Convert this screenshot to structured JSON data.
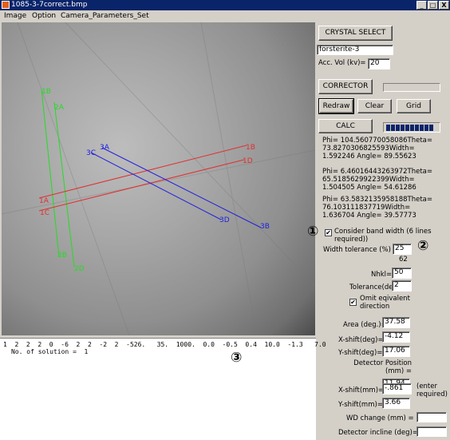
{
  "window": {
    "title": "1085-3-7correct.bmp",
    "min_label": "_",
    "max_label": "□",
    "close_label": "X"
  },
  "menu": {
    "items": [
      "Image",
      "Option",
      "Camera_Parameters_Set"
    ]
  },
  "image": {
    "band_labels": {
      "green": [
        "1B",
        "2A",
        "2B",
        "2D"
      ],
      "red": [
        "1B",
        "1D",
        "1A",
        "1C"
      ],
      "blue": [
        "3A",
        "3C",
        "3D",
        "3B"
      ]
    },
    "colors": {
      "green": "#22dd22",
      "red": "#e03030",
      "blue": "#2020e0"
    }
  },
  "console": {
    "line1": "1  2  2  2  0  -6  2  2  -2  2  -526.   35.  1000.  0.0  -0.5  0.4  10.0  -1.3   7.0",
    "line2": "No. of solution =  1",
    "marker3": "③"
  },
  "panel": {
    "crystal_select_label": "CRYSTAL SELECT",
    "crystal_name": "forsterite-3",
    "acc_vol_label": "Acc. Vol (kv)=",
    "acc_vol_value": "20",
    "corrector_label": "CORRECTOR",
    "redraw_label": "Redraw",
    "clear_label": "Clear",
    "grid_label": "Grid",
    "calc_label": "CALC",
    "calc_progress": 1.0,
    "results": [
      [
        "Phi= 104.560770058086Theta=",
        "73.8270306825593Width=",
        "1.592246  Angle= 89.55623"
      ],
      [
        "Phi= 6.46016443263972Theta=",
        "65.5185629922399Width=",
        "1.504505  Angle= 54.61286"
      ],
      [
        "Phi= 63.5832135958188Theta=",
        "76.103111837719Width=",
        "1.636704  Angle= 39.57773"
      ]
    ],
    "marker1": "①",
    "consider_band_width_label": [
      "Consider band width (6 lines",
      "required))"
    ],
    "consider_band_width_checked": true,
    "marker2": "②",
    "width_tolerance_label": "Width tolerance (%) =",
    "width_tolerance_value": "25",
    "count_62": "62",
    "nhkl_label": "Nhkl=",
    "nhkl_value": "50",
    "tolerance_label": "Tolerance(deg.)=",
    "tolerance_value": "2",
    "omit_label": [
      "Omit eqivalent",
      "direction"
    ],
    "omit_checked": true,
    "area_label": "Area (deg.)=",
    "area_value": "37.58",
    "xshift_deg_label": "X-shift(deg)=",
    "xshift_deg_value": "-4.12",
    "yshift_deg_label": "Y-shift(deg)=",
    "yshift_deg_value": "17.06",
    "detector_position_label": [
      "Detector Position",
      "(mm) ="
    ],
    "detector_position_value": "11.94",
    "xshift_mm_label": "X-shift(mm)=",
    "xshift_mm_value": "-.861",
    "enter_required_label": [
      "(enter",
      "required)"
    ],
    "yshift_mm_label": "Y-shift(mm)=",
    "yshift_mm_value": "3.66",
    "wd_change_label": "WD change (mm) =",
    "wd_change_value": "",
    "detector_incline_label": "Detector incline (deg)=",
    "detector_incline_value": ""
  }
}
